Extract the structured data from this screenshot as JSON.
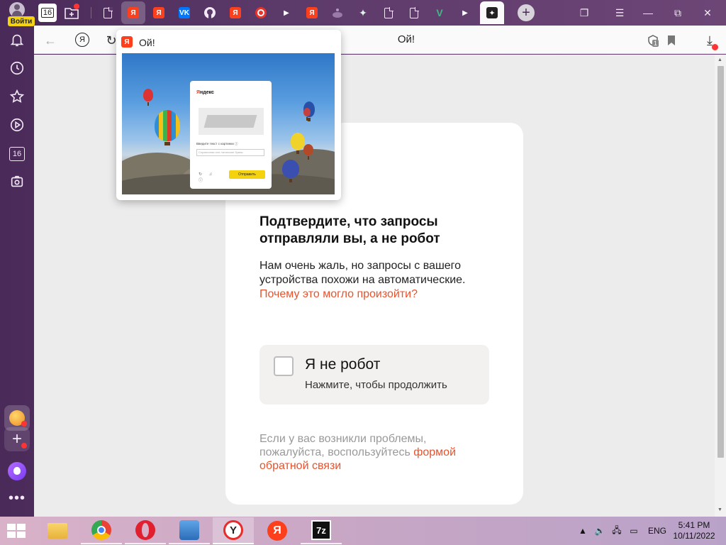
{
  "sidebar": {
    "login_label": "Войти",
    "tab_count": "16"
  },
  "tabstrip": {
    "home_tab_count": "16",
    "new_tab_symbol": "+"
  },
  "toolbar": {
    "page_title": "Ой!",
    "yandex_letter": "Я",
    "shield_badge": "1"
  },
  "preview": {
    "title": "Ой!",
    "favicon_letter": "Я",
    "mini_logo_prefix": "Я",
    "mini_logo_rest": "ндекс",
    "mini_label": "Введите текст с картинки ⓘ",
    "mini_placeholder": "Справочная или латинские буквы",
    "mini_submit": "Отправить"
  },
  "captcha": {
    "heading": "Подтвердите, что запросы отправляли вы, а не робот",
    "text": "Нам очень жаль, но запросы с вашего устройства похожи на автоматические. ",
    "text_link": "Почему это могло произойти?",
    "checkbox_title": "Я не робот",
    "checkbox_subtitle": "Нажмите, чтобы продолжить",
    "problem_text": "Если у вас возникли проблемы, пожалуйста, воспользуйтесь ",
    "problem_link": "формой обратной связи"
  },
  "taskbar": {
    "lang": "ENG",
    "time": "5:41 PM",
    "date": "10/11/2022",
    "app_7z": "7z"
  },
  "colors": {
    "accent_link": "#e8522c",
    "yandex_red": "#fc3f1d",
    "yandex_yellow": "#f5d20e",
    "frame_purple": "#5c3a6a"
  }
}
